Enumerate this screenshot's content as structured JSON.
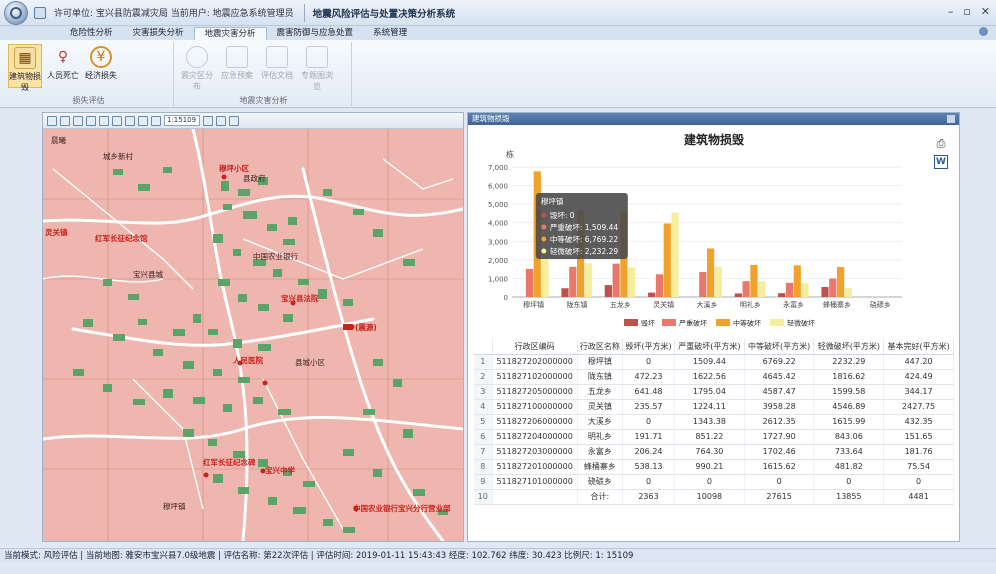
{
  "titlebar": {
    "meta": "许可单位: 宝兴县防震减灾局  当前用户: 地震应急系统管理员",
    "app_title": "地震风险评估与处置决策分析系统",
    "controls": [
      "–",
      "▫",
      "✕"
    ]
  },
  "tabs": [
    "危险性分析",
    "灾害损失分析",
    "地震灾害分析",
    "震害防御与应急处置",
    "系统管理"
  ],
  "active_tab": 2,
  "ribbon": {
    "groups": [
      {
        "title": "损失评估",
        "buttons": [
          {
            "label": "建筑物损毁",
            "icon": "building-icon",
            "selected": true
          },
          {
            "label": "人员死亡",
            "icon": "person-icon"
          },
          {
            "label": "经济损失",
            "icon": "money-icon"
          }
        ]
      },
      {
        "title": "地震灾害分析",
        "buttons": [
          {
            "label": "震灾区分布",
            "icon": "region-icon",
            "disabled": true
          },
          {
            "label": "应急预案",
            "icon": "document-icon",
            "disabled": true
          },
          {
            "label": "评估文档",
            "icon": "report-icon",
            "disabled": true
          },
          {
            "label": "专题图浏览",
            "icon": "thematic-map-icon",
            "disabled": true
          }
        ]
      }
    ]
  },
  "map": {
    "scale_value": "1:15109",
    "labels": [
      "晨曦",
      "城乡新村",
      "穆坪小区",
      "县政府",
      "中国农业银行",
      "宝兴县法院",
      "灵关镇",
      "红军长征纪念馆",
      "宝兴县城",
      "(震源)",
      "人民医院",
      "红军长征纪念碑",
      "中国农业银行宝兴分行营业部",
      "县城小区",
      "宝兴中学",
      "穆坪镇"
    ]
  },
  "chart_panel": {
    "header": "建筑物损毁"
  },
  "chart_data": {
    "type": "bar",
    "title": "建筑物损毁",
    "ylabel": "栋",
    "ylim": [
      0,
      7000
    ],
    "yticks": [
      "0",
      "1,000",
      "2,000",
      "3,000",
      "4,000",
      "5,000",
      "6,000",
      "7,000"
    ],
    "categories": [
      "穆坪镇",
      "陇东镇",
      "五龙乡",
      "灵关镇",
      "大溪乡",
      "明礼乡",
      "永富乡",
      "蜂桶寨乡",
      "硗碛乡"
    ],
    "series": [
      {
        "name": "毁坏",
        "color": "#c0504d",
        "values": [
          0,
          472.23,
          641.48,
          235.57,
          0,
          191.71,
          206.24,
          538.13,
          0
        ]
      },
      {
        "name": "严重破坏",
        "color": "#e9786a",
        "values": [
          1509.44,
          1622.56,
          1795.04,
          1224.11,
          1343.38,
          851.22,
          764.3,
          990.21,
          0
        ]
      },
      {
        "name": "中等破坏",
        "color": "#f0a22a",
        "values": [
          6769.22,
          4645.42,
          4587.47,
          3958.28,
          2612.35,
          1727.9,
          1702.46,
          1615.62,
          0
        ]
      },
      {
        "name": "轻微破坏",
        "color": "#f4ee9d",
        "values": [
          2232.29,
          1816.62,
          1599.58,
          4546.89,
          1615.99,
          843.06,
          733.64,
          481.82,
          0
        ]
      }
    ],
    "tooltip": {
      "title": "穆坪镇",
      "rows": [
        "毁坏: 0",
        "严重破坏: 1,509.44",
        "中等破坏: 6,769.22",
        "轻微破坏: 2,232.29"
      ]
    }
  },
  "table": {
    "headers": [
      "",
      "行政区编码",
      "行政区名称",
      "毁坏(平方米)",
      "严重破坏(平方米)",
      "中等破坏(平方米)",
      "轻微破坏(平方米)",
      "基本完好(平方米)"
    ],
    "rows": [
      [
        "1",
        "511827202000000",
        "穆坪镇",
        "0",
        "1509.44",
        "6769.22",
        "2232.29",
        "447.20"
      ],
      [
        "2",
        "511827102000000",
        "陇东镇",
        "472.23",
        "1622.56",
        "4645.42",
        "1816.62",
        "424.49"
      ],
      [
        "3",
        "511827205000000",
        "五龙乡",
        "641.48",
        "1795.04",
        "4587.47",
        "1599.58",
        "344.17"
      ],
      [
        "4",
        "511827100000000",
        "灵关镇",
        "235.57",
        "1224.11",
        "3958.28",
        "4546.89",
        "2427.75"
      ],
      [
        "5",
        "511827206000000",
        "大溪乡",
        "0",
        "1343.38",
        "2612.35",
        "1615.99",
        "432.35"
      ],
      [
        "6",
        "511827204000000",
        "明礼乡",
        "191.71",
        "851.22",
        "1727.90",
        "843.06",
        "151.65"
      ],
      [
        "7",
        "511827203000000",
        "永富乡",
        "206.24",
        "764.30",
        "1702.46",
        "733.64",
        "181.76"
      ],
      [
        "8",
        "511827201000000",
        "蜂桶寨乡",
        "538.13",
        "990.21",
        "1615.62",
        "481.82",
        "75.54"
      ],
      [
        "9",
        "511827101000000",
        "硗碛乡",
        "0",
        "0",
        "0",
        "0",
        "0"
      ],
      [
        "10",
        "",
        "合计:",
        "2363",
        "10098",
        "27615",
        "13855",
        "4481"
      ]
    ]
  },
  "statusbar": "当前模式: 风险评估 | 当前地图: 雅安市宝兴县7.0级地震 | 评估名称: 第22次评估 | 评估时间: 2019-01-11 15:43:43  经度: 102.762  纬度: 30.423  比例尺: 1: 15109"
}
